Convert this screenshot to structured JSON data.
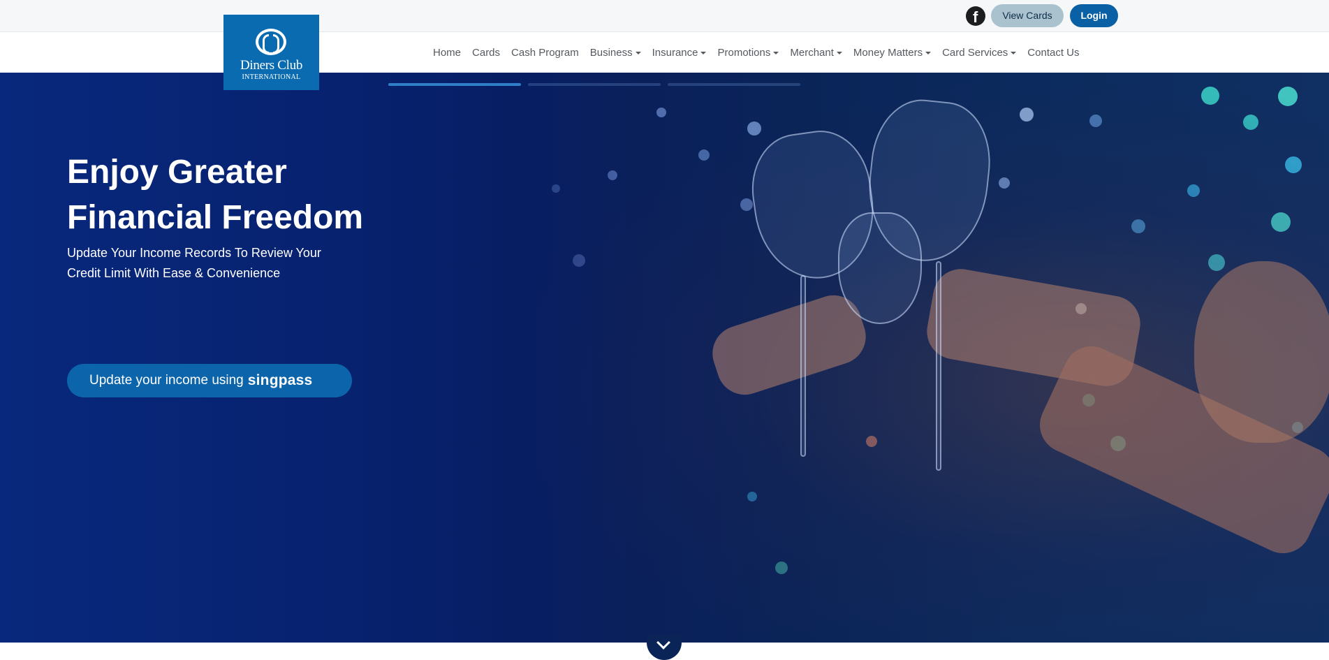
{
  "topbar": {
    "facebook_icon": "facebook-icon",
    "view_cards_label": "View Cards",
    "login_label": "Login"
  },
  "logo": {
    "name": "Diners Club",
    "sub": "INTERNATIONAL"
  },
  "nav": {
    "items": [
      {
        "label": "Home",
        "dropdown": false
      },
      {
        "label": "Cards",
        "dropdown": false
      },
      {
        "label": "Cash Program",
        "dropdown": false
      },
      {
        "label": "Business",
        "dropdown": true
      },
      {
        "label": "Insurance",
        "dropdown": true
      },
      {
        "label": "Promotions",
        "dropdown": true
      },
      {
        "label": "Merchant",
        "dropdown": true
      },
      {
        "label": "Money Matters",
        "dropdown": true
      },
      {
        "label": "Card Services",
        "dropdown": true
      },
      {
        "label": "Contact Us",
        "dropdown": false
      }
    ]
  },
  "hero": {
    "title_line1": "Enjoy Greater",
    "title_line2": "Financial Freedom",
    "subtitle_line1": "Update Your Income Records To Review Your",
    "subtitle_line2": "Credit Limit With Ease & Convenience",
    "cta_text": "Update your income using",
    "cta_brand": "singpass",
    "slides": 3,
    "active_slide": 1
  },
  "colors": {
    "brand_blue": "#0b6bb1",
    "login_blue": "#0a60a4",
    "view_cards_bg": "#a9c2ce"
  },
  "scroll_down_icon": "chevron-down-icon"
}
